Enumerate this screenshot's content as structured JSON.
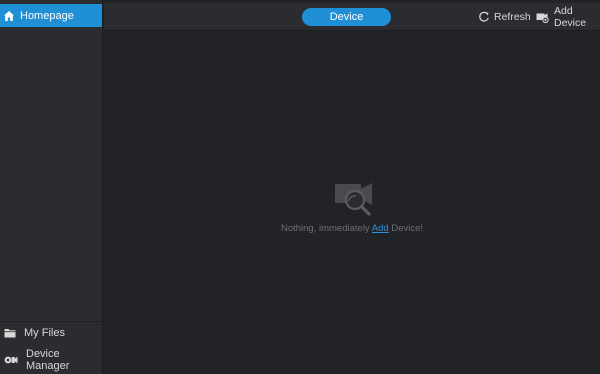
{
  "sidebar": {
    "home_label": "Homepage",
    "bottom_items": [
      {
        "label": "My Files",
        "icon": "folder-icon"
      },
      {
        "label": "Device Manager",
        "icon": "camera-settings-icon"
      }
    ]
  },
  "topbar": {
    "tab_label": "Device",
    "refresh_label": "Refresh",
    "add_device_label": "Add Device"
  },
  "empty_state": {
    "message_before": "Nothing, immediately ",
    "link_text": "Add",
    "message_after": " Device!",
    "illustration_icon": "camera-search-icon"
  },
  "colors": {
    "accent": "#1f8fd6",
    "sidebar_bg": "#2b2c30",
    "content_bg": "#222326",
    "link": "#2b93dd"
  }
}
